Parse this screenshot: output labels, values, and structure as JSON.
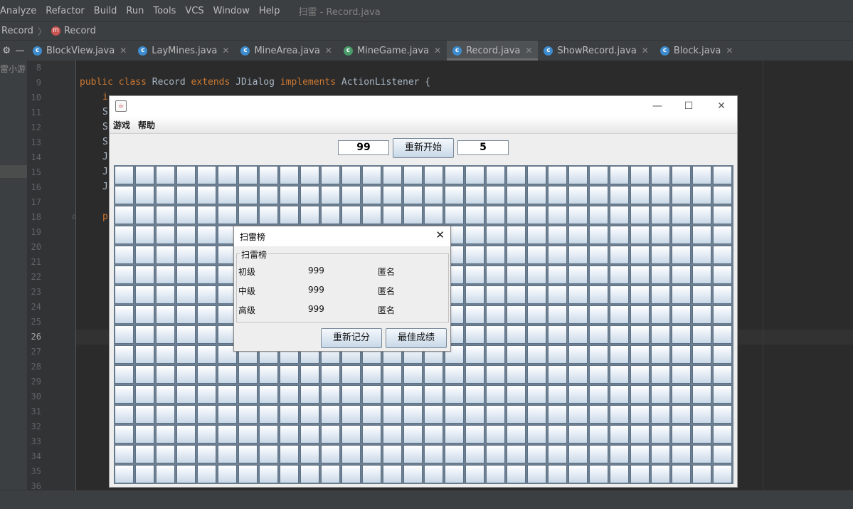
{
  "ide": {
    "menu": [
      "Analyze",
      "Refactor",
      "Build",
      "Run",
      "Tools",
      "VCS",
      "Window",
      "Help"
    ],
    "window_title": "扫雷 - Record.java",
    "breadcrumb": {
      "first": "Record",
      "second": "Record"
    },
    "project_label": "雷小游",
    "tabs": [
      {
        "label": "BlockView.java",
        "active": false
      },
      {
        "label": "LayMines.java",
        "active": false
      },
      {
        "label": "MineArea.java",
        "active": false
      },
      {
        "label": "MineGame.java",
        "active": false
      },
      {
        "label": "Record.java",
        "active": true
      },
      {
        "label": "ShowRecord.java",
        "active": false
      },
      {
        "label": "Block.java",
        "active": false
      }
    ],
    "line_numbers": [
      "8",
      "9",
      "10",
      "11",
      "12",
      "13",
      "14",
      "15",
      "16",
      "17",
      "18",
      "19",
      "20",
      "21",
      "22",
      "23",
      "24",
      "25",
      "26",
      "27",
      "28",
      "29",
      "30",
      "31",
      "32",
      "33",
      "34",
      "35",
      "36"
    ],
    "current_line": "26",
    "code": {
      "line9": {
        "kw1": "public class",
        "name": "Record",
        "kw2": "extends",
        "base": "JDialog",
        "kw3": "implements",
        "iface": "ActionListener {"
      },
      "line10": "i",
      "line11": "S",
      "line12": "S",
      "line13": "S",
      "line14": "J",
      "line15": "J",
      "line16": "J",
      "line18": "p"
    }
  },
  "game": {
    "menu": [
      "游戏",
      "帮助"
    ],
    "mine_count": "99",
    "restart_label": "重新开始",
    "timer": "5",
    "grid": {
      "columns": 30,
      "rows": 16
    }
  },
  "record_dialog": {
    "title": "扫雷榜",
    "group_title": "扫雷榜",
    "rows": [
      {
        "level": "初级",
        "time": "999",
        "name": "匿名"
      },
      {
        "level": "中级",
        "time": "999",
        "name": "匿名"
      },
      {
        "level": "高级",
        "time": "999",
        "name": "匿名"
      }
    ],
    "reset_label": "重新记分",
    "best_label": "最佳成绩"
  }
}
